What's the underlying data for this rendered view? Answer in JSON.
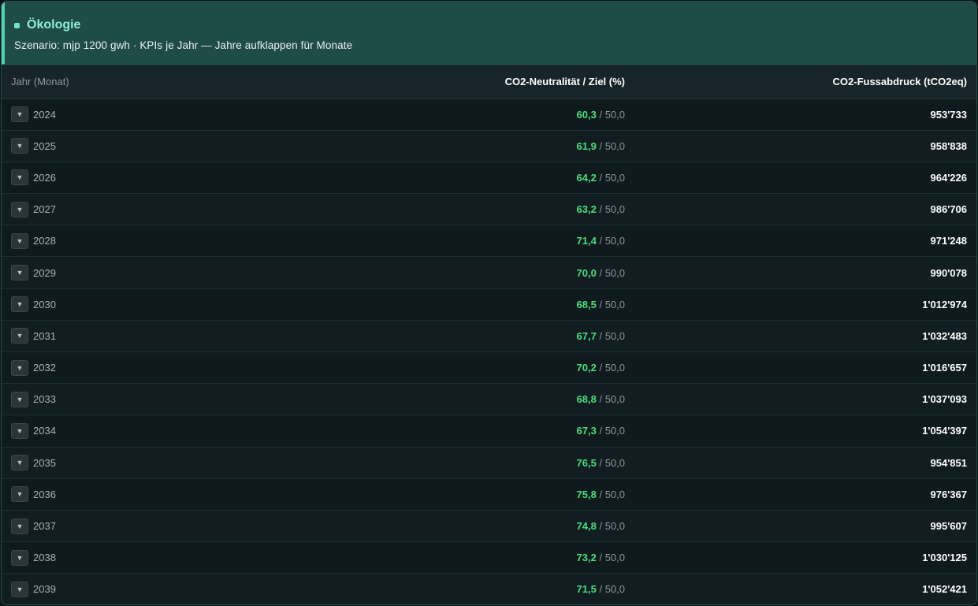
{
  "header": {
    "title": "Ökologie",
    "subtitle": "Szenario: mjp 1200 gwh · KPIs je Jahr — Jahre aufklappen für Monate"
  },
  "table": {
    "columns": [
      "Jahr (Monat)",
      "CO2-Neutralität / Ziel (%)",
      "CO2-Fussabdruck (tCO2eq)"
    ],
    "toggle_glyph": "▼",
    "separator": "/",
    "rows": [
      {
        "year": "2024",
        "neutrality": "60,3",
        "target": "50,0",
        "footprint": "953'733"
      },
      {
        "year": "2025",
        "neutrality": "61,9",
        "target": "50,0",
        "footprint": "958'838"
      },
      {
        "year": "2026",
        "neutrality": "64,2",
        "target": "50,0",
        "footprint": "964'226"
      },
      {
        "year": "2027",
        "neutrality": "63,2",
        "target": "50,0",
        "footprint": "986'706"
      },
      {
        "year": "2028",
        "neutrality": "71,4",
        "target": "50,0",
        "footprint": "971'248"
      },
      {
        "year": "2029",
        "neutrality": "70,0",
        "target": "50,0",
        "footprint": "990'078"
      },
      {
        "year": "2030",
        "neutrality": "68,5",
        "target": "50,0",
        "footprint": "1'012'974"
      },
      {
        "year": "2031",
        "neutrality": "67,7",
        "target": "50,0",
        "footprint": "1'032'483"
      },
      {
        "year": "2032",
        "neutrality": "70,2",
        "target": "50,0",
        "footprint": "1'016'657"
      },
      {
        "year": "2033",
        "neutrality": "68,8",
        "target": "50,0",
        "footprint": "1'037'093"
      },
      {
        "year": "2034",
        "neutrality": "67,3",
        "target": "50,0",
        "footprint": "1'054'397"
      },
      {
        "year": "2035",
        "neutrality": "76,5",
        "target": "50,0",
        "footprint": "954'851"
      },
      {
        "year": "2036",
        "neutrality": "75,8",
        "target": "50,0",
        "footprint": "976'367"
      },
      {
        "year": "2037",
        "neutrality": "74,8",
        "target": "50,0",
        "footprint": "995'607"
      },
      {
        "year": "2038",
        "neutrality": "73,2",
        "target": "50,0",
        "footprint": "1'030'125"
      },
      {
        "year": "2039",
        "neutrality": "71,5",
        "target": "50,0",
        "footprint": "1'052'421"
      }
    ]
  },
  "colors": {
    "accent": "#4fd1b5",
    "positive": "#4ade80",
    "header_bg": "#1f4b49"
  }
}
